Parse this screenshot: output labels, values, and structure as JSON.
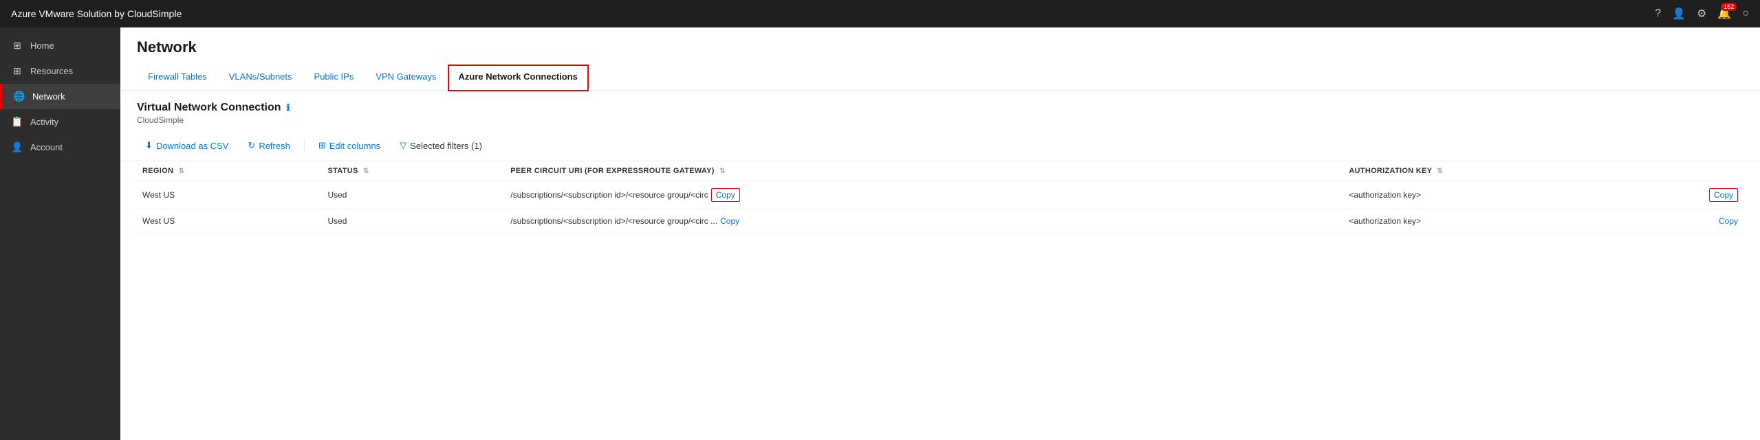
{
  "topbar": {
    "title": "Azure VMware Solution by CloudSimple",
    "icons": [
      "help",
      "account",
      "settings",
      "notification",
      "user"
    ],
    "notification_count": "152"
  },
  "sidebar": {
    "items": [
      {
        "id": "home",
        "label": "Home",
        "icon": "⊞",
        "active": false
      },
      {
        "id": "resources",
        "label": "Resources",
        "icon": "⊞",
        "active": false
      },
      {
        "id": "network",
        "label": "Network",
        "icon": "👤",
        "active": true
      },
      {
        "id": "activity",
        "label": "Activity",
        "icon": "📋",
        "active": false
      },
      {
        "id": "account",
        "label": "Account",
        "icon": "👤",
        "active": false
      }
    ]
  },
  "page": {
    "title": "Network",
    "tabs": [
      {
        "id": "firewall",
        "label": "Firewall Tables",
        "active": false
      },
      {
        "id": "vlans",
        "label": "VLANs/Subnets",
        "active": false
      },
      {
        "id": "publicips",
        "label": "Public IPs",
        "active": false
      },
      {
        "id": "vpn",
        "label": "VPN Gateways",
        "active": false
      },
      {
        "id": "azure",
        "label": "Azure Network Connections",
        "active": true
      }
    ],
    "sub_title": "Virtual Network Connection",
    "company": "CloudSimple",
    "toolbar": {
      "download_label": "Download as CSV",
      "refresh_label": "Refresh",
      "edit_columns_label": "Edit columns",
      "filters_label": "Selected filters (1)"
    },
    "table": {
      "columns": [
        {
          "id": "region",
          "label": "REGION"
        },
        {
          "id": "status",
          "label": "STATUS"
        },
        {
          "id": "peer_circuit_uri",
          "label": "PEER CIRCUIT URI (FOR EXPRESSROUTE GATEWAY)"
        },
        {
          "id": "auth_key",
          "label": "AUTHORIZATION KEY"
        }
      ],
      "rows": [
        {
          "region": "West US",
          "status": "Used",
          "peer_circuit_uri": "/subscriptions/<subscription id>/<resource group/<circ",
          "uri_copy_label": "Copy",
          "uri_copy_boxed": true,
          "auth_key": "<authorization key>",
          "auth_copy_label": "Copy",
          "auth_copy_boxed": true
        },
        {
          "region": "West US",
          "status": "Used",
          "peer_circuit_uri": "/subscriptions/<subscription id>/<resource group/<circ ...",
          "uri_copy_label": "Copy",
          "uri_copy_boxed": false,
          "auth_key": "<authorization key>",
          "auth_copy_label": "Copy",
          "auth_copy_boxed": false
        }
      ]
    }
  }
}
